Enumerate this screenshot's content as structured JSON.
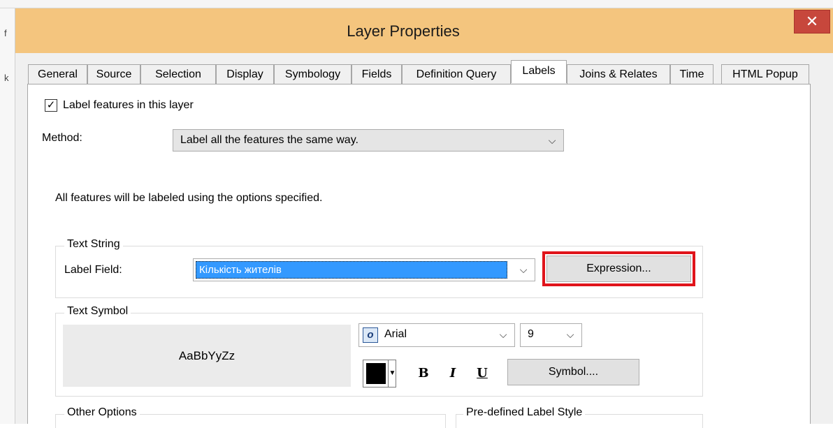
{
  "window": {
    "title": "Layer Properties",
    "close_glyph": "✕",
    "side_glyphs": [
      "f",
      "k"
    ]
  },
  "tabs": [
    {
      "label": "General"
    },
    {
      "label": "Source"
    },
    {
      "label": "Selection"
    },
    {
      "label": "Display"
    },
    {
      "label": "Symbology"
    },
    {
      "label": "Fields"
    },
    {
      "label": "Definition Query"
    },
    {
      "label": "Labels",
      "active": true
    },
    {
      "label": "Joins & Relates"
    },
    {
      "label": "Time"
    },
    {
      "label": "HTML Popup"
    }
  ],
  "labels_tab": {
    "label_features": {
      "checked": true,
      "text": "Label features in this layer",
      "check_glyph": "✓"
    },
    "method": {
      "label": "Method:",
      "value": "Label all the features the same way."
    },
    "description": "All features will be labeled using the options specified.",
    "text_string": {
      "legend": "Text String",
      "label_field_label": "Label Field:",
      "label_field_value": "Кількість жителів",
      "expression_button": "Expression..."
    },
    "text_symbol": {
      "legend": "Text Symbol",
      "preview_text": "AaBbYyZz",
      "font_name": "Arial",
      "font_icon_glyph": "o",
      "font_size": "9",
      "color": "#000000",
      "bold": "B",
      "italic": "I",
      "underline": "U",
      "symbol_button": "Symbol...."
    },
    "other_options": {
      "legend": "Other Options"
    },
    "predefined_style": {
      "legend": "Pre-defined Label Style"
    }
  },
  "dropdown_glyph": "⌵"
}
